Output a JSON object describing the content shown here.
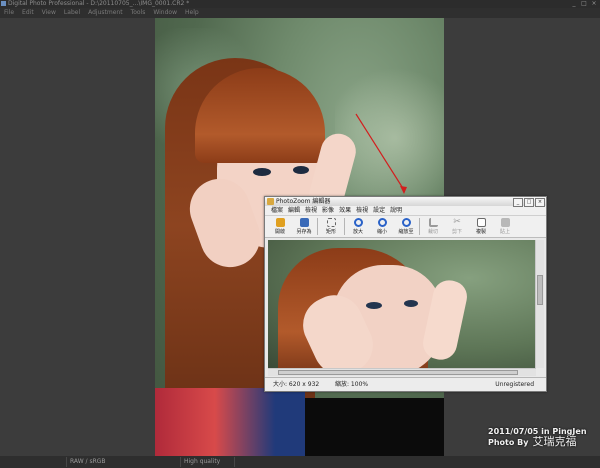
{
  "app": {
    "title": "Digital Photo Professional - D:\\20110705_...\\IMG_0001.CR2 *",
    "window_buttons": [
      "_",
      "□",
      "×"
    ],
    "menu": [
      "File",
      "Edit",
      "View",
      "Label",
      "Adjustment",
      "Tools",
      "Window",
      "Help"
    ]
  },
  "inner_window": {
    "title": "PhotoZoom 編輯器",
    "window_buttons": [
      "_",
      "□",
      "×"
    ],
    "menu": [
      "檔案",
      "編輯",
      "檢視",
      "影像",
      "效果",
      "檢視",
      "設定",
      "說明"
    ],
    "toolbar": [
      {
        "label": "開啟",
        "icon": "open-icon",
        "color": "#e0a020",
        "enabled": true
      },
      {
        "label": "另存為",
        "icon": "save-icon",
        "color": "#3a6ab8",
        "enabled": true
      },
      {
        "label": "矩形",
        "icon": "select-rect-icon",
        "color": "#7a7a7a",
        "enabled": true
      },
      {
        "label": "放大",
        "icon": "zoom-in-icon",
        "color": "#2a62c8",
        "enabled": true
      },
      {
        "label": "縮小",
        "icon": "zoom-out-icon",
        "color": "#2a62c8",
        "enabled": true
      },
      {
        "label": "縮放至",
        "icon": "zoom-fit-icon",
        "color": "#2a62c8",
        "enabled": true
      },
      {
        "label": "裁切",
        "icon": "crop-icon",
        "color": "#9a9a9a",
        "enabled": false
      },
      {
        "label": "剪下",
        "icon": "cut-icon",
        "color": "#9a9a9a",
        "enabled": false
      },
      {
        "label": "複製",
        "icon": "copy-icon",
        "color": "#6a6a6a",
        "enabled": true
      },
      {
        "label": "貼上",
        "icon": "paste-icon",
        "color": "#9a9a9a",
        "enabled": false
      }
    ],
    "status": {
      "size": "大小: 620 x 932",
      "zoom": "縮放: 100%",
      "registration": "Unregistered"
    }
  },
  "watermark": {
    "line1": "2011/07/05 in PingJen",
    "line2": "Photo By",
    "signature": "艾瑞克福"
  },
  "statusbar": {
    "format": "RAW / sRGB",
    "quality": "High quality"
  }
}
